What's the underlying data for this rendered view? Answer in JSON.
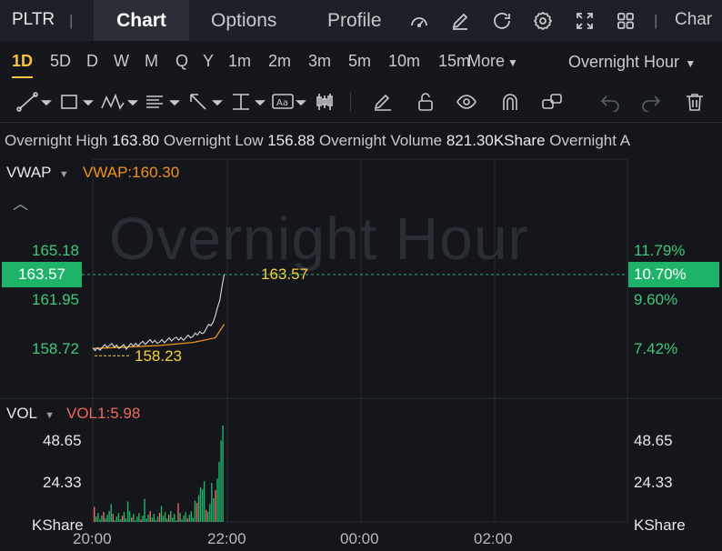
{
  "header": {
    "ticker": "PLTR",
    "tabs": [
      {
        "label": "Chart"
      },
      {
        "label": "Options"
      },
      {
        "label": "Profile"
      }
    ],
    "cut_tab": "Char",
    "icons": [
      "gauge-icon",
      "edit-icon",
      "refresh-icon",
      "settings-icon",
      "fullscreen-icon",
      "grid-icon"
    ]
  },
  "periods": {
    "items": [
      "1D",
      "5D",
      "D",
      "W",
      "M",
      "Q",
      "Y",
      "1m",
      "2m",
      "3m",
      "5m",
      "10m",
      "15m"
    ],
    "active": "1D",
    "more_label": "More",
    "session_label": "Overnight Hour"
  },
  "info": {
    "high_label": "Overnight High",
    "high_value": "163.80",
    "low_label": "Overnight Low",
    "low_value": "156.88",
    "volume_label": "Overnight Volume",
    "volume_value": "821.30KShare",
    "cut_label": "Overnight A"
  },
  "price_panel": {
    "indicator": "VWAP",
    "indicator_value": "VWAP:160.30",
    "watermark": "Overnight Hour",
    "y_left": [
      "165.18",
      "161.95",
      "158.72"
    ],
    "y_right": [
      "11.79%",
      "9.60%",
      "7.42%"
    ],
    "current_price": "163.57",
    "current_pct": "10.70%",
    "current_price_label": "163.57",
    "low_marker_label": "158.23"
  },
  "volume_panel": {
    "indicator": "VOL",
    "indicator_value": "VOL1:5.98",
    "y_left": [
      "48.65",
      "24.33"
    ],
    "y_right": [
      "48.65",
      "24.33"
    ],
    "unit_left": "KShare",
    "unit_right": "KShare"
  },
  "x_axis": [
    "20:00",
    "22:00",
    "00:00",
    "02:00"
  ],
  "colors": {
    "up": "#1fb36a",
    "down": "#f06a5a",
    "vwap": "#f0931a",
    "accent": "#f5c542",
    "price_line": "#d8d8d8"
  },
  "chart_data": {
    "type": "line",
    "x_range": [
      "20:00",
      "03:00"
    ],
    "price_series": [
      {
        "time": "20:00",
        "value": 158.6
      },
      {
        "time": "20:15",
        "value": 158.9
      },
      {
        "time": "20:30",
        "value": 158.8
      },
      {
        "time": "20:45",
        "value": 159.1
      },
      {
        "time": "21:00",
        "value": 159.2
      },
      {
        "time": "21:15",
        "value": 159.3
      },
      {
        "time": "21:30",
        "value": 159.5
      },
      {
        "time": "21:40",
        "value": 159.9
      },
      {
        "time": "21:48",
        "value": 160.4
      },
      {
        "time": "21:54",
        "value": 161.9
      },
      {
        "time": "21:58",
        "value": 163.57
      }
    ],
    "vwap_series": [
      {
        "time": "20:00",
        "value": 158.7
      },
      {
        "time": "20:30",
        "value": 158.8
      },
      {
        "time": "21:00",
        "value": 158.9
      },
      {
        "time": "21:30",
        "value": 159.1
      },
      {
        "time": "21:50",
        "value": 159.4
      },
      {
        "time": "21:58",
        "value": 160.3
      }
    ],
    "price_ylim": [
      157.5,
      166.5
    ],
    "volume_max": 58,
    "volume_ylim": [
      0,
      58
    ]
  }
}
